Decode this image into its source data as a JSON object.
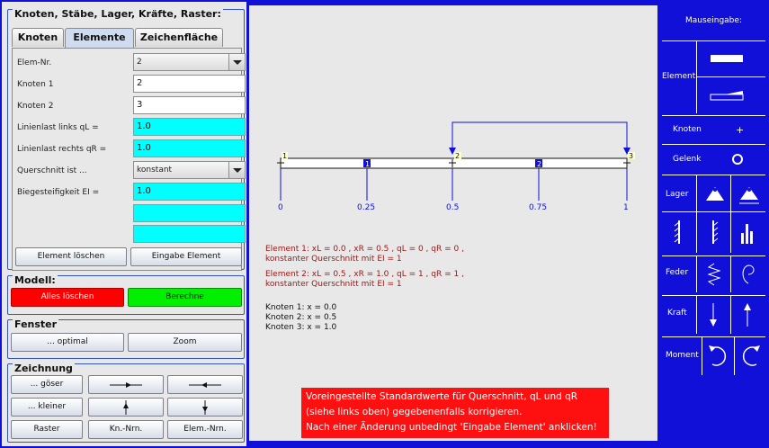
{
  "colors": {
    "frame": "#1010d8",
    "cyan": "#00ffff",
    "red_button": "#ff0000",
    "green_button": "#00f000",
    "warning": "#ff1010"
  },
  "left_panel": {
    "group_title": "Knoten, Stäbe, Lager, Kräfte, Raster:",
    "tabs": [
      "Knoten",
      "Elemente",
      "Zeichenfläche"
    ],
    "active_tab": "Elemente",
    "fields": {
      "elem_nr": {
        "label": "Elem-Nr.",
        "value": "2"
      },
      "knoten1": {
        "label": "Knoten 1",
        "value": "2"
      },
      "knoten2": {
        "label": "Knoten 2",
        "value": "3"
      },
      "ql": {
        "label": "Linienlast links qL =",
        "value": "1.0"
      },
      "qr": {
        "label": "Linienlast rechts qR =",
        "value": "1.0"
      },
      "querschnitt": {
        "label": "Querschnitt ist ...",
        "value": "konstant"
      },
      "ei": {
        "label": "Biegesteifigkeit EI =",
        "value": "1.0"
      }
    },
    "buttons": {
      "delete": "Element löschen",
      "input": "Eingabe Element"
    }
  },
  "modell": {
    "title": "Modell:",
    "clear_all": "Alles löschen",
    "compute": "Berechne"
  },
  "fenster": {
    "title": "Fenster",
    "optimal": "... optimal",
    "zoom": "Zoom"
  },
  "zeichnung": {
    "title": "Zeichnung",
    "bigger": "... göser",
    "smaller": "... kleiner",
    "raster": "Raster",
    "kn_nrn": "Kn.-Nrn.",
    "elem_nrn": "Elem.-Nrn."
  },
  "canvas": {
    "axis_ticks": [
      "0",
      "0.25",
      "0.5",
      "0.75",
      "1"
    ],
    "node_labels": [
      "1",
      "2",
      "3"
    ],
    "element_labels": [
      "1",
      "2"
    ],
    "element1_line1": "Element 1:  xL = 0.0 ,   xR = 0.5 ,    qL = 0 ,    qR = 0 ,",
    "element1_line2": "konstanter Querschnitt mit EI = 1",
    "element2_line1": "Element 2:  xL = 0.5 ,   xR = 1.0 ,   qL = 1 ,    qR = 1 ,",
    "element2_line2": "konstanter Querschnitt mit EI = 1",
    "knoten1": "Knoten 1:  x = 0.0",
    "knoten2": "Knoten 2:  x = 0.5",
    "knoten3": "Knoten 3:  x = 1.0",
    "warning_line1": "Voreingestellte Standardwerte für Querschnitt, qL und qR",
    "warning_line2": "(siehe links oben) gegebenenfalls korrigieren.",
    "warning_line3": "Nach einer Änderung unbedingt 'Eingabe Element' anklicken!"
  },
  "right_panel": {
    "title": "Mauseingabe:",
    "element": "Element",
    "knoten": "Knoten",
    "knoten_plus": "+",
    "gelenk": "Gelenk",
    "lager": "Lager",
    "feder": "Feder",
    "kraft": "Kraft",
    "moment": "Moment"
  }
}
